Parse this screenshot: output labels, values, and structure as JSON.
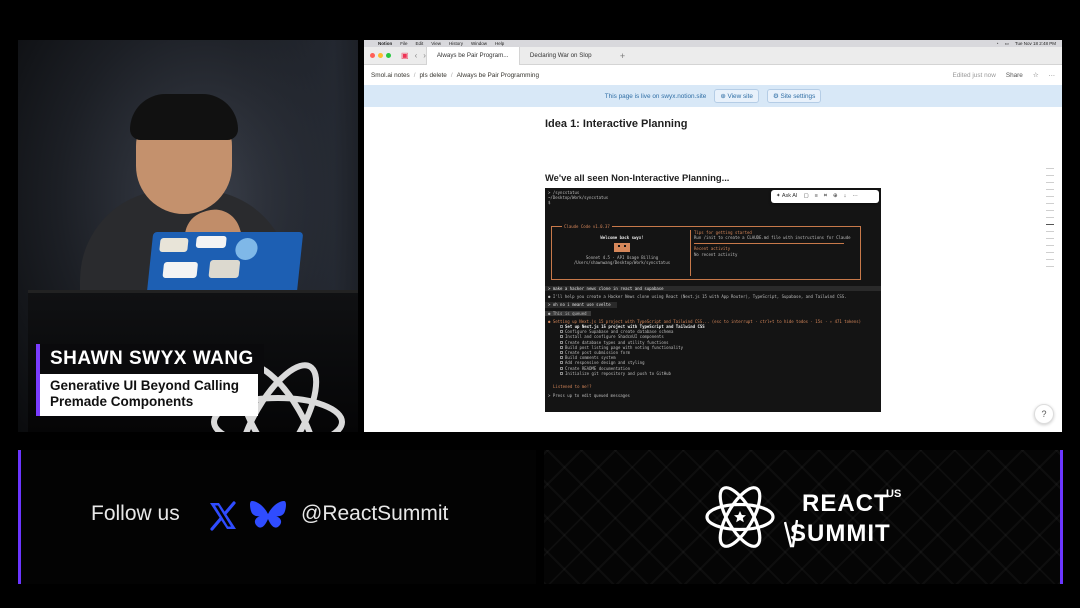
{
  "speaker": {
    "name": "SHAWN SWYX WANG",
    "talk_title": "Generative UI Beyond Calling Premade Components",
    "laptop_stickers": [
      "Swyx",
      "smol",
      "SWYX"
    ]
  },
  "mac_menubar": {
    "items": [
      "Notion",
      "File",
      "Edit",
      "View",
      "History",
      "Window",
      "Help"
    ],
    "clock": "Tue Nov 18  2:48 PM"
  },
  "browser": {
    "tabs": [
      {
        "label": "Always be Pair Program...",
        "active": true
      },
      {
        "label": "Declaring War on Slop",
        "active": false
      }
    ]
  },
  "notion": {
    "breadcrumbs": [
      "Smol.ai notes",
      "pls delete",
      "Always be Pair Programming"
    ],
    "edited": "Edited just now",
    "share_label": "Share",
    "banner_text": "This page is live on swyx.notion.site",
    "view_site_label": "View site",
    "site_settings_label": "Site settings",
    "heading": "Idea 1: Interactive Planning",
    "section_heading": "We've all seen Non-Interactive Planning..."
  },
  "terminal": {
    "toolbar_ask_ai": "Ask AI",
    "lines_top": [
      "> /syncstatus",
      "",
      "~/Desktop/Work/syncstatus",
      "$"
    ],
    "welcome_title": "Claude Code v1.0.37",
    "welcome_greeting": "Welcome back swyx!",
    "welcome_model": "Sonnet 4.5 · API Usage Billing",
    "welcome_path": "/Users/shawnwang/Desktop/Work/syncstatus",
    "tips_title": "Tips for getting started",
    "tips_body": "Run /init to create a CLAUDE.md file with instructions for Claude",
    "recent_title": "Recent activity",
    "recent_body": "No recent activity",
    "prompt_1": "> make a hacker news clone in react and supabase",
    "response_1": "● I'll help you create a Hacker News clone using React (Next.js 15 with App Router), TypeScript, Supabase, and Tailwind CSS.",
    "prompt_2": "> oh no i meant use svelte",
    "interrupt": "● This is queued",
    "plan_line": "● Setting up Next.js 15 project with TypeScript and Tailwind CSS... (esc to interrupt · ctrl+t to hide todos · 15s · ↑ 471 tokens)",
    "todos": [
      "Set up Next.js 15 project with TypeScript and Tailwind CSS",
      "Configure Supabase and create database schema",
      "Install and configure ShadcnUI components",
      "Create database types and utility functions",
      "Build post listing page with voting functionality",
      "Create post submission form",
      "Build comments system",
      "Add responsive design and styling",
      "Create README documentation",
      "Initialize git repository and push to GitHub"
    ],
    "footer_1": "Listened to me!?",
    "footer_2": "> Press up to edit queued messages"
  },
  "follow": {
    "label": "Follow us",
    "handle": "@ReactSummit"
  },
  "brand": {
    "word_1": "REACT",
    "superscript": "US",
    "word_2": "SUMMIT"
  },
  "colors": {
    "accent_purple": "#6b36ff",
    "social_icon_blue": "#2f4cff",
    "notion_banner": "#d8e8f7",
    "terminal_orange": "#d6875a"
  },
  "icons": [
    "x-icon",
    "bluesky-icon",
    "react-logo-icon",
    "help-icon"
  ]
}
